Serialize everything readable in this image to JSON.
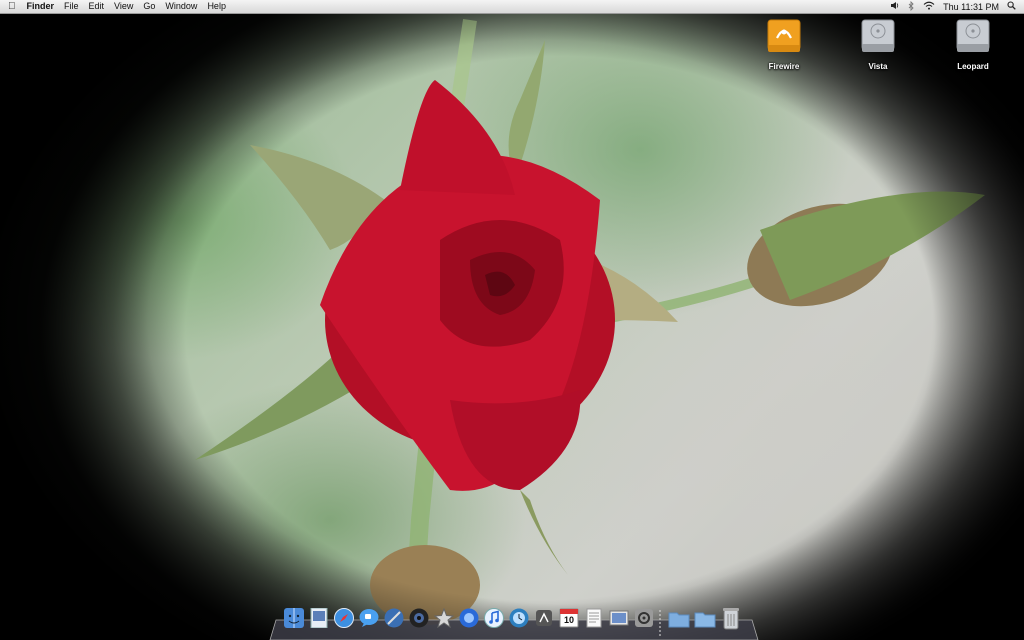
{
  "menubar": {
    "apple_icon": "apple-icon",
    "app_name": "Finder",
    "menus": [
      "File",
      "Edit",
      "View",
      "Go",
      "Window",
      "Help"
    ],
    "clock": "Thu 11:31 PM",
    "status_icons": [
      "volume-icon",
      "bluetooth-icon",
      "wifi-icon",
      "spotlight-icon"
    ]
  },
  "desktop_icons": [
    {
      "label": "Firewire",
      "icon": "firewire-drive-icon",
      "color": "#f0a020"
    },
    {
      "label": "Vista",
      "icon": "hard-drive-icon",
      "color": "#b8bcc2"
    },
    {
      "label": "Leopard",
      "icon": "hard-drive-icon",
      "color": "#b8bcc2"
    }
  ],
  "dock": {
    "items": [
      "finder-icon",
      "preview-icon",
      "safari-icon",
      "ichat-icon",
      "xcode-icon",
      "photo-booth-icon",
      "utility-icon",
      "quicktime-icon",
      "itunes-icon",
      "time-machine-icon",
      "dashboard-icon",
      "calendar-icon",
      "textedit-icon",
      "photos-icon",
      "system-preferences-icon",
      "applications-folder-icon",
      "documents-folder-icon",
      "trash-icon"
    ],
    "calendar_day": "10"
  }
}
